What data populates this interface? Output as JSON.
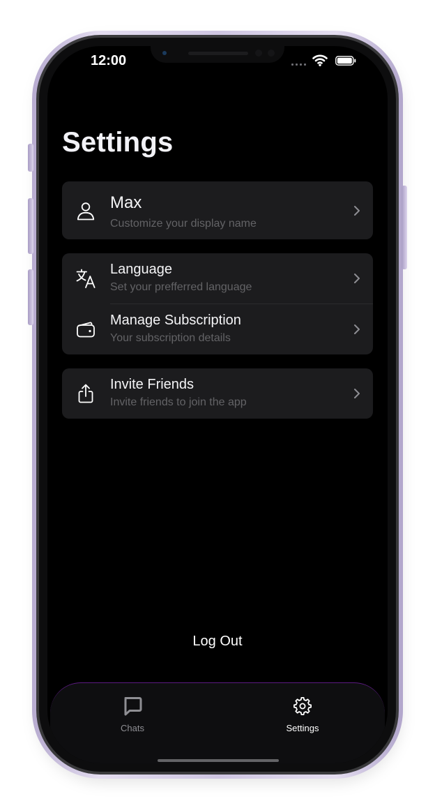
{
  "status_bar": {
    "time": "12:00"
  },
  "page": {
    "title": "Settings"
  },
  "groups": [
    {
      "items": [
        {
          "icon": "person-icon",
          "title": "Max",
          "subtitle": "Customize your display name"
        }
      ]
    },
    {
      "items": [
        {
          "icon": "translate-icon",
          "title": "Language",
          "subtitle": "Set your prefferred language"
        },
        {
          "icon": "wallet-icon",
          "title": "Manage Subscription",
          "subtitle": "Your subscription details"
        }
      ]
    },
    {
      "items": [
        {
          "icon": "share-icon",
          "title": "Invite Friends",
          "subtitle": "Invite friends to join the app"
        }
      ]
    }
  ],
  "logout_label": "Log Out",
  "tabbar": {
    "tabs": [
      {
        "label": "Chats",
        "icon": "chat-bubble-icon",
        "active": false
      },
      {
        "label": "Settings",
        "icon": "gear-icon",
        "active": true
      }
    ]
  },
  "colors": {
    "background": "#000000",
    "card": "#1c1c1e",
    "subtitle": "#636366",
    "tab_accent_border": "#5c1b83",
    "frame": "#cfc6e2"
  }
}
